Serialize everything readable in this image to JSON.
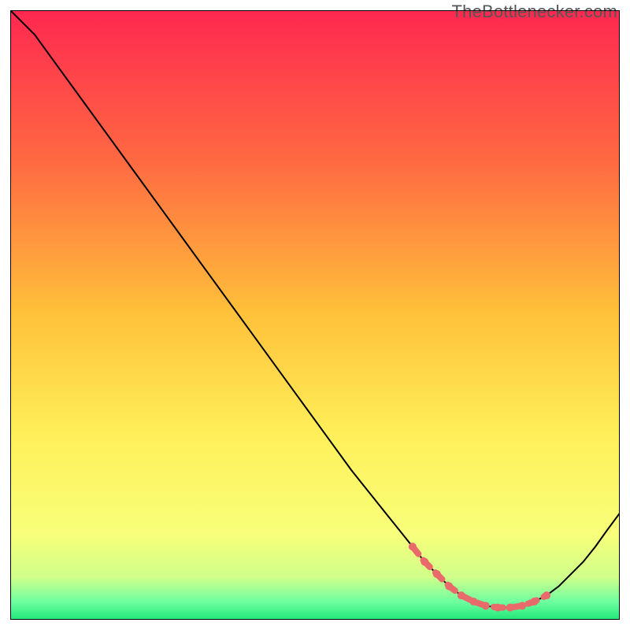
{
  "watermark": "TheBottlenecker.com",
  "chart_data": {
    "type": "line",
    "title": "",
    "xlabel": "",
    "ylabel": "",
    "xlim": [
      0,
      100
    ],
    "ylim": [
      0,
      100
    ],
    "grid": false,
    "gradient_stops": [
      {
        "offset": 0,
        "color": "#ff2850"
      },
      {
        "offset": 0.25,
        "color": "#ff6a42"
      },
      {
        "offset": 0.5,
        "color": "#ffc23a"
      },
      {
        "offset": 0.7,
        "color": "#fff05a"
      },
      {
        "offset": 0.86,
        "color": "#f8ff7a"
      },
      {
        "offset": 0.93,
        "color": "#d0ff8a"
      },
      {
        "offset": 0.97,
        "color": "#70ffa0"
      },
      {
        "offset": 1.0,
        "color": "#20e878"
      }
    ],
    "series": [
      {
        "name": "bottleneck-curve",
        "color": "#000000",
        "x": [
          0.0,
          4.0,
          8.0,
          12.0,
          16.0,
          20.0,
          24.0,
          28.0,
          32.0,
          36.0,
          40.0,
          44.0,
          48.0,
          52.0,
          56.0,
          60.0,
          64.0,
          66.0,
          68.0,
          70.0,
          72.0,
          74.0,
          76.0,
          78.0,
          80.0,
          82.0,
          84.0,
          86.0,
          88.0,
          90.0,
          92.0,
          94.0,
          96.0,
          98.0,
          100.0
        ],
        "y": [
          100.0,
          96.0,
          90.5,
          85.0,
          79.5,
          74.0,
          68.5,
          63.0,
          57.5,
          52.0,
          46.5,
          41.0,
          35.5,
          30.0,
          24.5,
          19.5,
          14.5,
          12.0,
          9.5,
          7.5,
          5.5,
          4.0,
          3.0,
          2.3,
          2.0,
          2.0,
          2.3,
          3.0,
          4.0,
          5.5,
          7.5,
          9.5,
          12.0,
          14.8,
          17.5
        ]
      }
    ],
    "marker_segment": {
      "name": "optimal-range-markers",
      "color": "#e86a6a",
      "x": [
        66.0,
        68.0,
        70.0,
        72.0,
        74.0,
        76.0,
        78.0,
        80.0,
        82.0,
        84.0,
        86.0,
        88.0
      ],
      "y": [
        12.0,
        9.5,
        7.5,
        5.5,
        4.0,
        3.0,
        2.3,
        2.0,
        2.0,
        2.3,
        3.0,
        4.0
      ]
    }
  }
}
